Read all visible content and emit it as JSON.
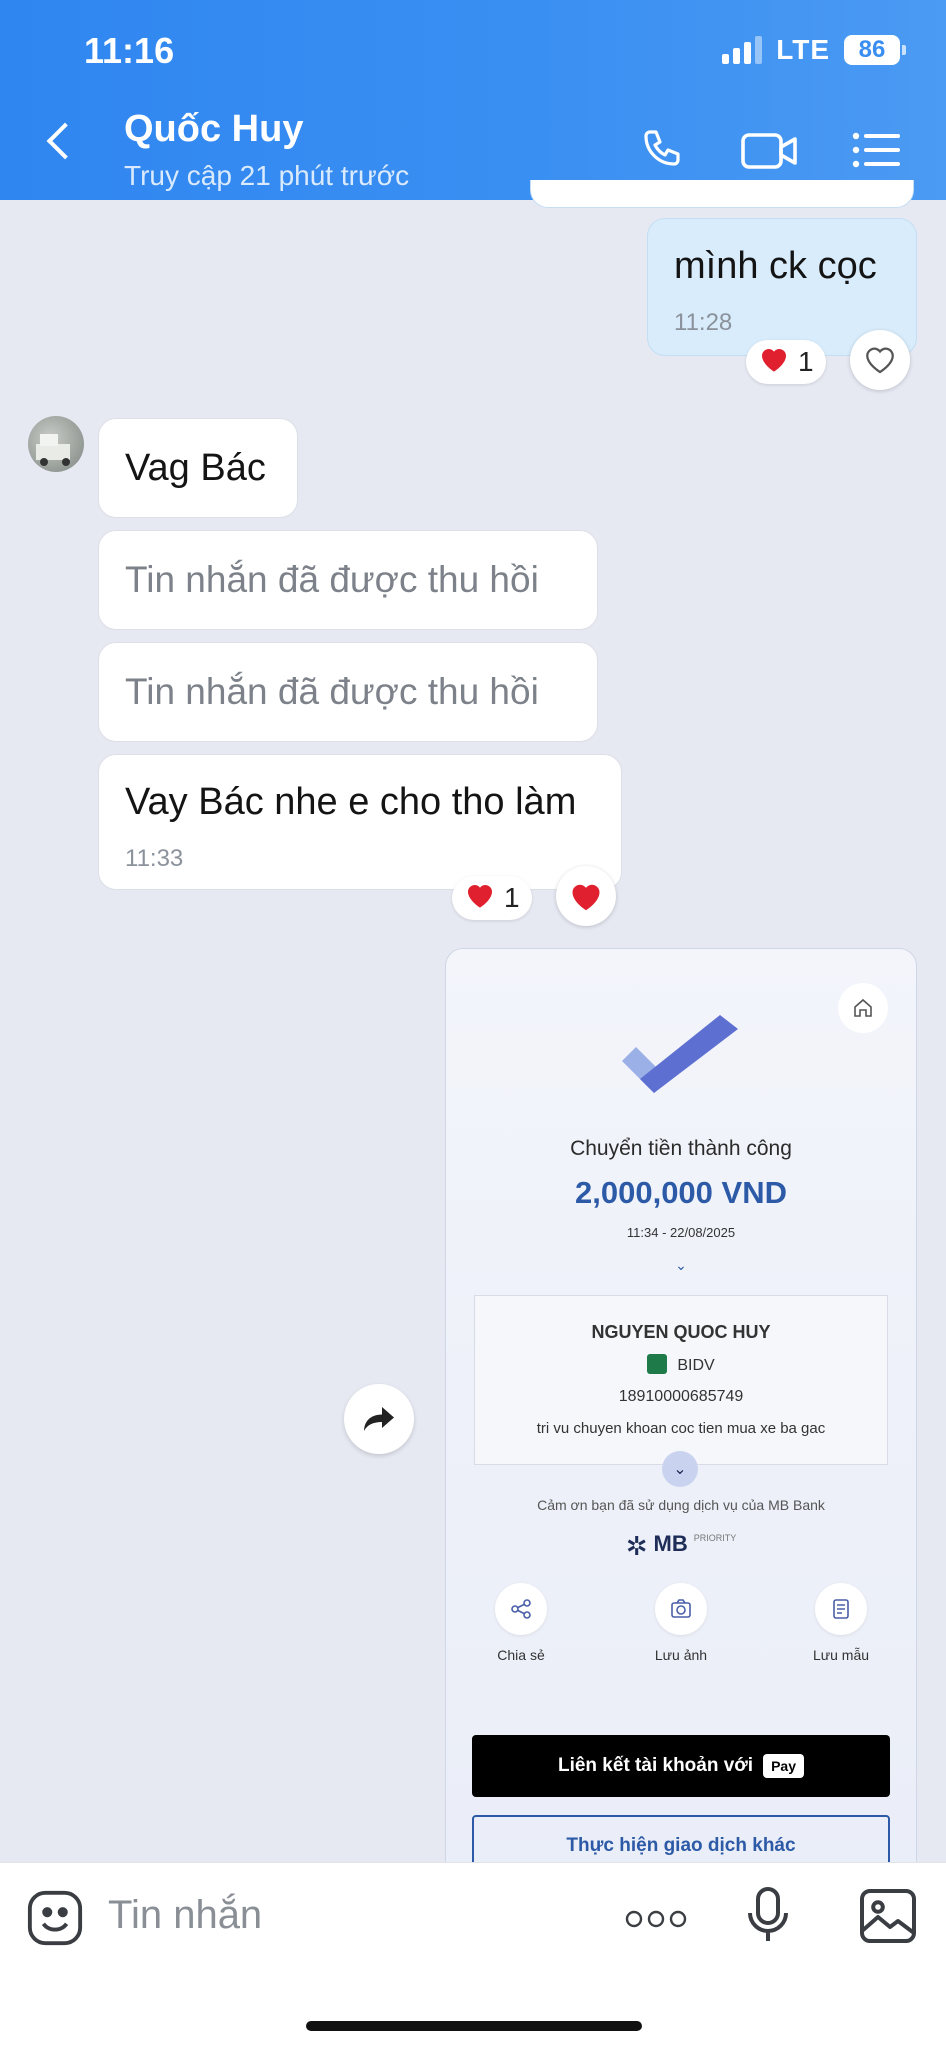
{
  "status_bar": {
    "time": "11:16",
    "network": "LTE",
    "battery": "86"
  },
  "header": {
    "contact_name": "Quốc Huy",
    "last_seen": "Truy cập 21 phút trước"
  },
  "messages": [
    {
      "side": "me",
      "text": "mình ck cọc",
      "time": "11:28",
      "reaction_count": "1"
    },
    {
      "side": "them",
      "text": "Vag Bác"
    },
    {
      "side": "them",
      "recalled": "Tin nhắn đã được thu hồi"
    },
    {
      "side": "them",
      "recalled": "Tin nhắn đã được thu hồi"
    },
    {
      "side": "them",
      "text": "Vay Bác nhe e cho tho làm",
      "time": "11:33",
      "reaction_count": "1"
    }
  ],
  "receipt": {
    "title": "Chuyển tiền thành công",
    "amount": "2,000,000 VND",
    "datetime": "11:34 - 22/08/2025",
    "recipient_name": "NGUYEN QUOC HUY",
    "bank": "BIDV",
    "account_number": "18910000685749",
    "note": "tri vu chuyen khoan coc tien mua xe ba gac",
    "thanks": "Cảm ơn bạn đã sử dụng dịch vụ của MB Bank",
    "logo_text": "MB",
    "logo_sub": "PRIORITY",
    "actions": [
      "Chia sẻ",
      "Lưu ảnh",
      "Lưu mẫu"
    ],
    "apple_pay_button": "Liên kết tài khoản với",
    "apple_pay_badge": "Pay",
    "other_transaction_button": "Thực hiện giao dịch khác"
  },
  "input": {
    "placeholder": "Tin nhắn"
  },
  "colors": {
    "header_blue": "#3a8ef1",
    "my_bubble": "#d8ecfc",
    "heart_red": "#e0202f",
    "mb_blue": "#2c5aa7"
  }
}
